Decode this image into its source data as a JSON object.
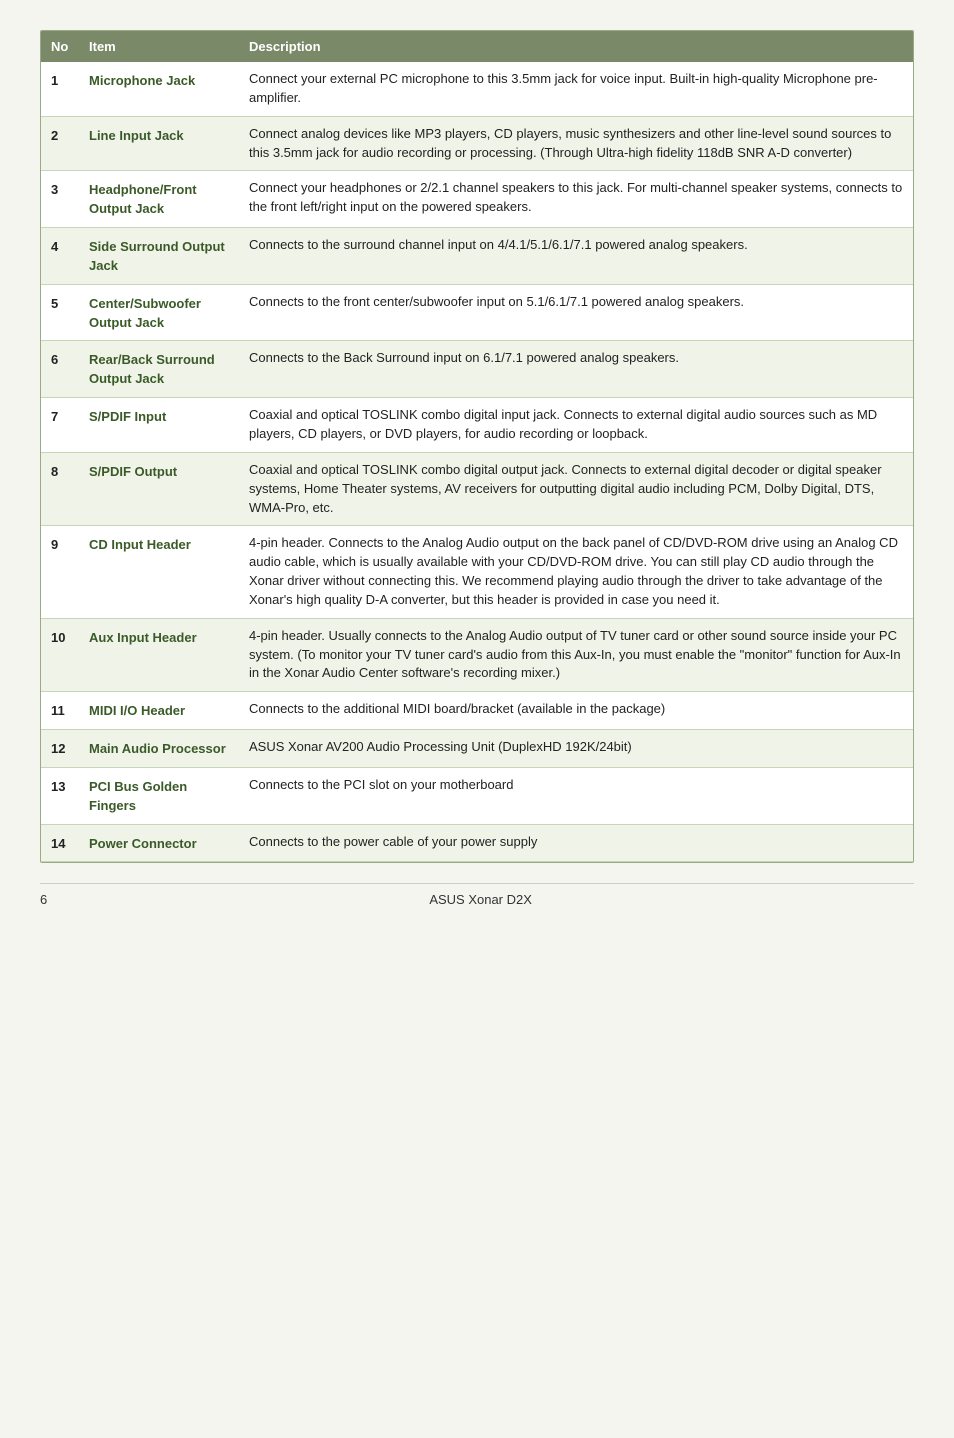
{
  "table": {
    "headers": [
      "No",
      "Item",
      "Description"
    ],
    "rows": [
      {
        "no": "1",
        "item": "Microphone Jack",
        "description": "Connect your external PC microphone to this 3.5mm jack for voice input. Built-in high-quality Microphone pre-amplifier."
      },
      {
        "no": "2",
        "item": "Line Input Jack",
        "description": "Connect analog devices like MP3 players, CD players, music synthesizers and other line-level sound sources to this 3.5mm jack for audio recording or processing. (Through Ultra-high fidelity 118dB SNR A-D converter)"
      },
      {
        "no": "3",
        "item": "Headphone/Front Output Jack",
        "description": "Connect your headphones or 2/2.1 channel speakers to this jack. For multi-channel speaker systems, connects to the front left/right input on the powered speakers."
      },
      {
        "no": "4",
        "item": "Side Surround Output Jack",
        "description": "Connects to the surround channel input on 4/4.1/5.1/6.1/7.1 powered analog speakers."
      },
      {
        "no": "5",
        "item": "Center/Subwoofer Output Jack",
        "description": "Connects to the front center/subwoofer input on 5.1/6.1/7.1 powered analog speakers."
      },
      {
        "no": "6",
        "item": "Rear/Back Surround Output Jack",
        "description": "Connects to the Back Surround input on 6.1/7.1 powered analog speakers."
      },
      {
        "no": "7",
        "item": "S/PDIF Input",
        "description": "Coaxial and optical TOSLINK combo digital input jack. Connects to external digital audio sources such as MD players, CD players, or DVD players, for audio recording or loopback."
      },
      {
        "no": "8",
        "item": "S/PDIF Output",
        "description": "Coaxial and optical TOSLINK combo digital output jack. Connects to external digital decoder or digital speaker systems, Home Theater systems, AV receivers for outputting digital audio including PCM, Dolby Digital, DTS, WMA-Pro, etc."
      },
      {
        "no": "9",
        "item": "CD Input Header",
        "description": "4-pin header. Connects to the Analog Audio output on the back panel of CD/DVD-ROM drive using an Analog CD audio cable, which is usually available with your CD/DVD-ROM drive. You can still play CD audio through the Xonar driver without connecting this. We recommend playing audio through the driver to take advantage of the Xonar's high quality D-A converter, but this header is provided in case you need it."
      },
      {
        "no": "10",
        "item": "Aux Input Header",
        "description": "4-pin header. Usually connects to the Analog Audio output of TV tuner card or other sound source inside your PC system. (To monitor your TV tuner card's audio from this Aux-In, you must enable the \"monitor\" function for Aux-In in the Xonar Audio Center software's recording mixer.)"
      },
      {
        "no": "11",
        "item": "MIDI I/O Header",
        "description": "Connects to the additional MIDI board/bracket (available in the package)"
      },
      {
        "no": "12",
        "item": "Main Audio Processor",
        "description": "ASUS Xonar AV200 Audio Processing Unit (DuplexHD 192K/24bit)"
      },
      {
        "no": "13",
        "item": "PCI Bus Golden Fingers",
        "description": "Connects to the PCI slot on your motherboard"
      },
      {
        "no": "14",
        "item": "Power Connector",
        "description": "Connects to the power cable of your power supply"
      }
    ]
  },
  "footer": {
    "page": "6",
    "title": "ASUS Xonar D2X"
  }
}
